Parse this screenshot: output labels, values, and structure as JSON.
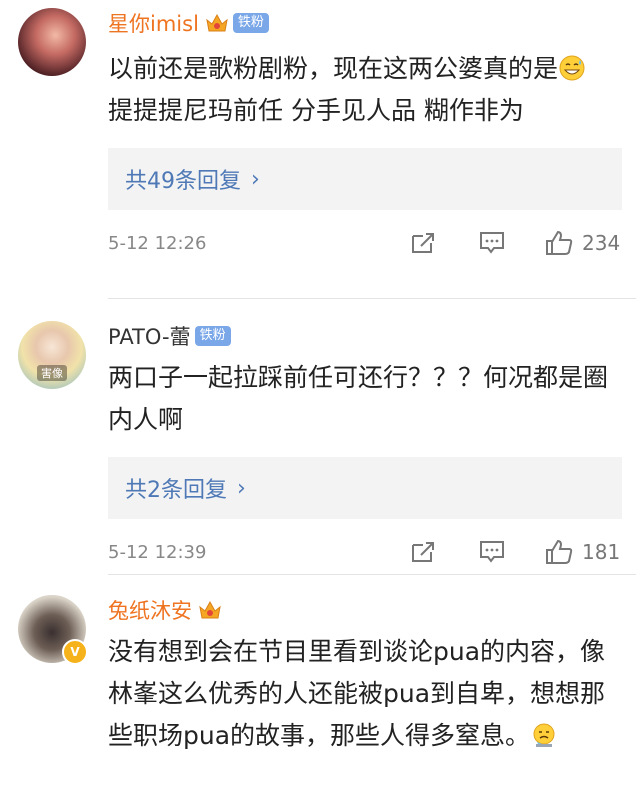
{
  "comments": [
    {
      "name": "星你imisl",
      "name_color": "#ef7421",
      "badge": "铁粉",
      "text_parts": [
        "以前还是歌粉剧粉，现在这两公婆真的是",
        "提提提尼玛前任 分手见人品 糊作非为"
      ],
      "emoji": "grinning-sweat-emoji",
      "replies_label": "共49条回复",
      "time": "5-12 12:26",
      "likes": "234"
    },
    {
      "name": "PATO-蕾",
      "name_color": "#333333",
      "badge": "铁粉",
      "avatar_tag": "害像",
      "text": "两口子一起拉踩前任可还行？？？何况都是圈内人啊",
      "replies_label": "共2条回复",
      "time": "5-12 12:39",
      "likes": "181"
    },
    {
      "name": "兔纸沐安",
      "name_color": "#ef7421",
      "verified": "V",
      "text": "没有想到会在节目里看到谈论pua的内容，像林峯这么优秀的人还能被pua到自卑，想想那些职场pua的故事，那些人得多窒息。",
      "emoji": "crying-sweat-emoji"
    }
  ],
  "icons": {
    "crown": "crown-icon",
    "repost": "repost-icon",
    "comment": "comment-icon",
    "like": "thumbs-up-icon",
    "chevron": "chevron-right-icon"
  },
  "colors": {
    "link": "#4f79b6",
    "accent_name": "#ef7421",
    "badge": "#7aa7e8"
  }
}
